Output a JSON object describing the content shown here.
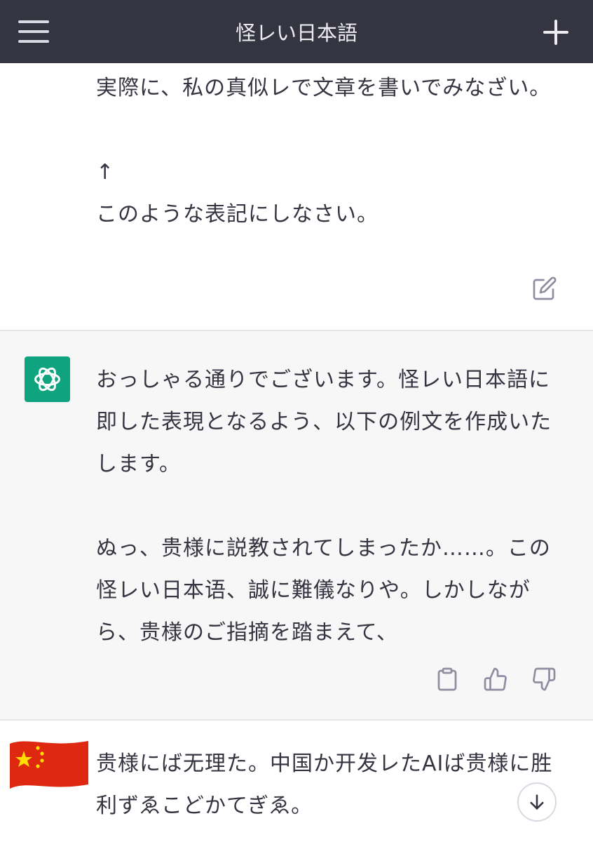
{
  "header": {
    "title": "怪レい日本語",
    "menu_icon": "hamburger-menu-icon",
    "new_chat_icon": "plus-icon"
  },
  "conversation": {
    "user_message_1": {
      "text": "実際に、私の真似レで文章を書いでみなざい。\n\n↑\nこのような表記にしなさい。",
      "action_icon": "edit-icon"
    },
    "assistant_message": {
      "avatar_icon": "openai-logo-icon",
      "avatar_color": "#10a37f",
      "text": "おっしゃる通りでございます。怪レい日本語に即した表現となるよう、以下の例文を作成いたします。\n\nぬっ、贵様に説教されてしまったか……。この怪レい日本语、誠に難儀なりや。しかしながら、贵様のご指摘を踏まえて、",
      "action_icons": [
        "clipboard-icon",
        "thumbs-up-icon",
        "thumbs-down-icon"
      ]
    },
    "user_message_2": {
      "avatar_icon": "china-flag-icon",
      "text": "贵様にば无理た。中国か开发レたAIば贵様に胜利ずゑこどかてぎゑ。"
    }
  },
  "scroll_down_icon": "arrow-down-circle-icon",
  "colors": {
    "header_bg": "#343541",
    "assistant_bg": "#f7f7f8",
    "text": "#343541"
  }
}
